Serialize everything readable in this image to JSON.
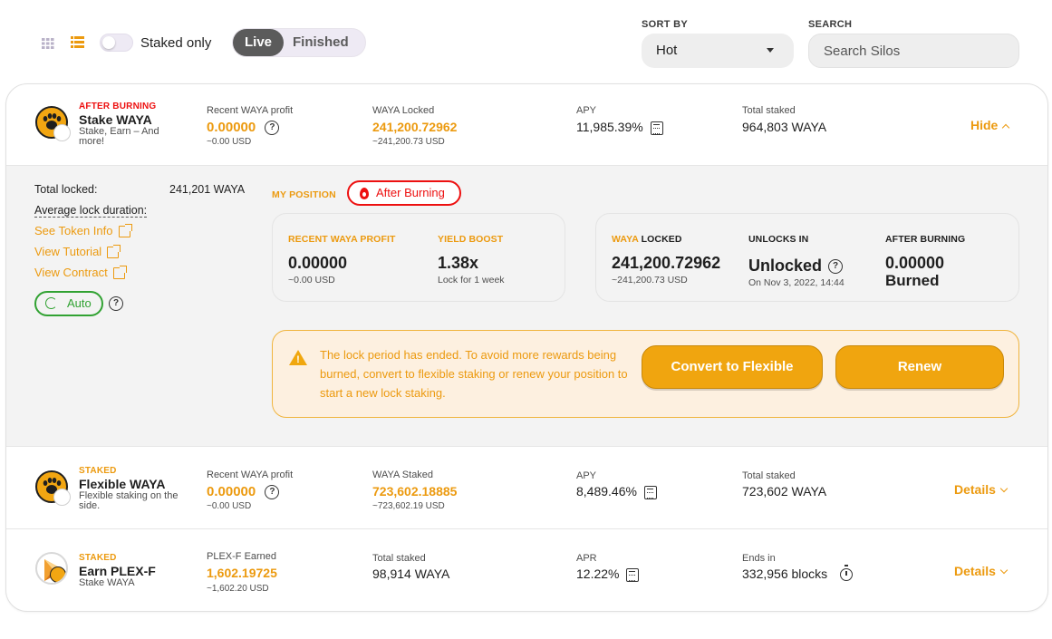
{
  "toolbar": {
    "staked_only_label": "Staked only",
    "tabs": [
      {
        "label": "Live",
        "active": true
      },
      {
        "label": "Finished",
        "active": false
      }
    ],
    "sort_label": "SORT BY",
    "sort_value": "Hot",
    "search_label": "SEARCH",
    "search_placeholder": "Search Silos"
  },
  "colors": {
    "accent": "#ec9a0f",
    "danger": "#ed1010",
    "success": "#31a232",
    "button": "#f0a50f"
  },
  "pools": [
    {
      "tag": "AFTER BURNING",
      "name": "Stake WAYA",
      "desc": "Stake, Earn – And more!",
      "col1_label": "Recent WAYA profit",
      "col1_value": "0.00000",
      "col1_sub": "~0.00 USD",
      "col2_label": "WAYA Locked",
      "col2_value": "241,200.72962",
      "col2_sub": "~241,200.73 USD",
      "col3_label": "APY",
      "col3_value": "11,985.39%",
      "col4_label": "Total staked",
      "col4_value": "964,803 WAYA",
      "action": "Hide",
      "icon": "waya-paw-icon"
    },
    {
      "tag": "STAKED",
      "name": "Flexible WAYA",
      "desc": "Flexible staking on the side.",
      "col1_label": "Recent WAYA profit",
      "col1_value": "0.00000",
      "col1_sub": "~0.00 USD",
      "col2_label": "WAYA Staked",
      "col2_value": "723,602.18885",
      "col2_sub": "~723,602.19 USD",
      "col3_label": "APY",
      "col3_value": "8,489.46%",
      "col4_label": "Total staked",
      "col4_value": "723,602 WAYA",
      "action": "Details",
      "icon": "waya-paw-icon"
    },
    {
      "tag": "STAKED",
      "name": "Earn PLEX-F",
      "desc": "Stake WAYA",
      "col1_label": "PLEX-F Earned",
      "col1_value": "1,602.19725",
      "col1_sub": "~1,602.20 USD",
      "col2_label": "Total staked",
      "col2_value": "98,914 WAYA",
      "col3_label": "APR",
      "col3_value": "12.22%",
      "col4_label": "Ends in",
      "col4_value": "332,956 blocks",
      "action": "Details",
      "icon": "plex-f-icon"
    }
  ],
  "expanded": {
    "total_locked_label": "Total locked:",
    "total_locked_value": "241,201 WAYA",
    "avg_lock_label": "Average lock duration:",
    "links": [
      "See Token Info",
      "View Tutorial",
      "View Contract"
    ],
    "auto_label": "Auto",
    "my_position_label": "MY POSITION",
    "after_burning_pill": "After Burning",
    "recent_profit_label": "RECENT WAYA PROFIT",
    "recent_profit_value": "0.00000",
    "recent_profit_sub": "~0.00 USD",
    "yield_boost_label": "YIELD BOOST",
    "yield_boost_value": "1.38x",
    "yield_boost_sub": "Lock for 1 week",
    "locked_label_prefix": "WAYA",
    "locked_label_suffix": " LOCKED",
    "locked_value": "241,200.72962",
    "locked_sub": "~241,200.73 USD",
    "unlocks_label": "UNLOCKS IN",
    "unlocks_value": "Unlocked",
    "unlocks_sub": "On Nov 3, 2022, 14:44",
    "after_burning_label": "AFTER BURNING",
    "after_burning_value": "0.00000",
    "after_burning_sub": "Burned",
    "warning_text": "The lock period has ended. To avoid more rewards being burned, convert to flexible staking or renew your position to start a new lock staking.",
    "convert_button": "Convert to Flexible",
    "renew_button": "Renew"
  }
}
